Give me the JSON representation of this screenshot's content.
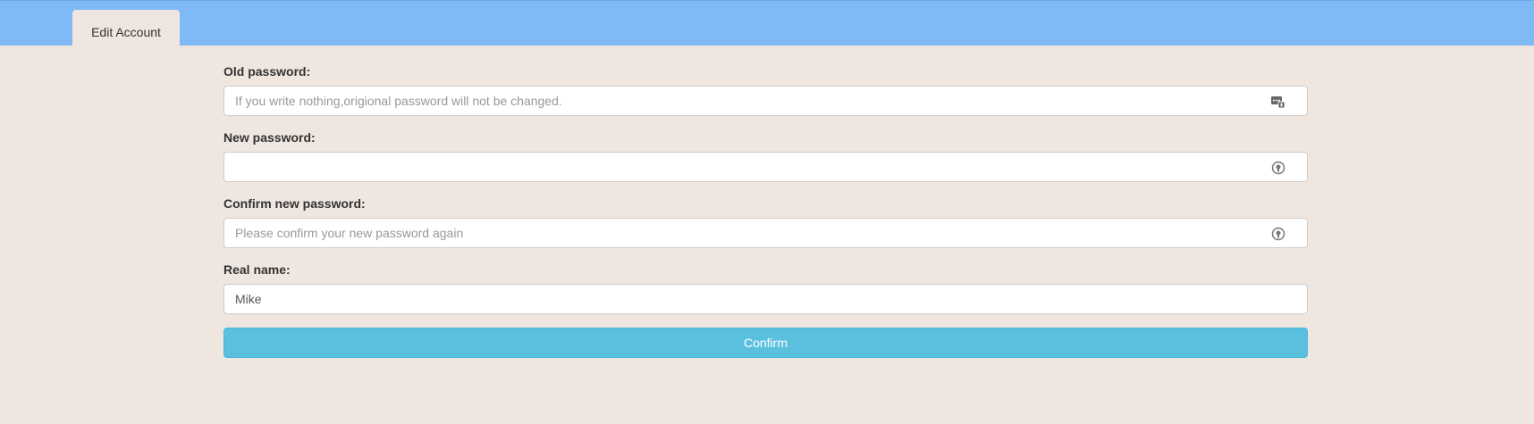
{
  "header": {
    "tab_label": "Edit Account"
  },
  "form": {
    "old_password": {
      "label": "Old password:",
      "value": "",
      "placeholder": "If you write nothing,origional password will not be changed.",
      "icon": "password-manager-icon"
    },
    "new_password": {
      "label": "New password:",
      "value": "",
      "placeholder": "",
      "icon": "key-lock-icon"
    },
    "confirm_password": {
      "label": "Confirm new password:",
      "value": "",
      "placeholder": "Please confirm your new password again",
      "icon": "key-lock-icon"
    },
    "real_name": {
      "label": "Real name:",
      "value": "Mike",
      "placeholder": ""
    },
    "confirm_button": "Confirm"
  },
  "colors": {
    "header_bg": "#7fbaf7",
    "page_bg": "#efe6e0",
    "button_bg": "#5bc0de"
  }
}
